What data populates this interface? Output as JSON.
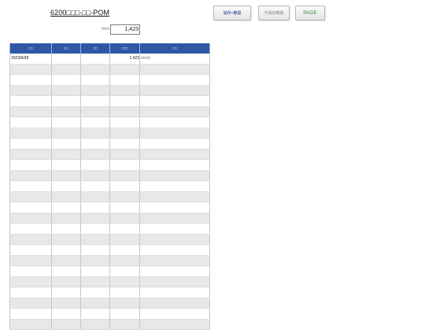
{
  "header": {
    "title": "6200□□□-□□-POM"
  },
  "toolbar": {
    "save_label": "儲存+離開",
    "nosave_label": "不儲存離開",
    "page_label": "PAGE"
  },
  "summary": {
    "label": "□□□:",
    "value": "1,423"
  },
  "table": {
    "columns": [
      "□□",
      "□□",
      "□□",
      "□□□",
      "□□"
    ],
    "rows": [
      [
        "2023/6/28",
        "",
        "",
        "1,423",
        "□□□□"
      ],
      [
        "",
        "",
        "",
        "",
        ""
      ],
      [
        "",
        "",
        "",
        "",
        ""
      ],
      [
        "",
        "",
        "",
        "",
        ""
      ],
      [
        "",
        "",
        "",
        "",
        ""
      ],
      [
        "",
        "",
        "",
        "",
        ""
      ],
      [
        "",
        "",
        "",
        "",
        ""
      ],
      [
        "",
        "",
        "",
        "",
        ""
      ],
      [
        "",
        "",
        "",
        "",
        ""
      ],
      [
        "",
        "",
        "",
        "",
        ""
      ],
      [
        "",
        "",
        "",
        "",
        ""
      ],
      [
        "",
        "",
        "",
        "",
        ""
      ],
      [
        "",
        "",
        "",
        "",
        ""
      ],
      [
        "",
        "",
        "",
        "",
        ""
      ],
      [
        "",
        "",
        "",
        "",
        ""
      ],
      [
        "",
        "",
        "",
        "",
        ""
      ],
      [
        "",
        "",
        "",
        "",
        ""
      ],
      [
        "",
        "",
        "",
        "",
        ""
      ],
      [
        "",
        "",
        "",
        "",
        ""
      ],
      [
        "",
        "",
        "",
        "",
        ""
      ],
      [
        "",
        "",
        "",
        "",
        ""
      ],
      [
        "",
        "",
        "",
        "",
        ""
      ],
      [
        "",
        "",
        "",
        "",
        ""
      ],
      [
        "",
        "",
        "",
        "",
        ""
      ],
      [
        "",
        "",
        "",
        "",
        ""
      ],
      [
        "",
        "",
        "",
        "",
        ""
      ]
    ]
  }
}
